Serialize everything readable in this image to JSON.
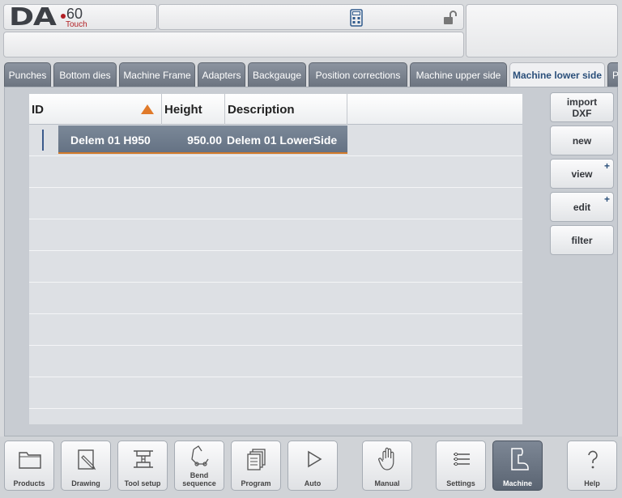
{
  "logo": {
    "brand": "DA",
    "model": "60",
    "touch": "Touch"
  },
  "tabs": [
    {
      "label": "Punches",
      "active": false
    },
    {
      "label": "Bottom dies",
      "active": false
    },
    {
      "label": "Machine Frame",
      "active": false
    },
    {
      "label": "Adapters",
      "active": false
    },
    {
      "label": "Backgauge",
      "active": false
    },
    {
      "label": "Position corrections",
      "active": false
    },
    {
      "label": "Machine upper side",
      "active": false
    },
    {
      "label": "Machine lower side",
      "active": true
    },
    {
      "label": "P",
      "active": false
    }
  ],
  "table": {
    "columns": [
      "ID",
      "Height",
      "Description"
    ],
    "rows": [
      {
        "id": "Delem 01 H950",
        "height": "950.00",
        "description": "Delem 01 LowerSide"
      }
    ]
  },
  "side_buttons": {
    "import_line1": "import",
    "import_line2": "DXF",
    "new": "new",
    "view": "view",
    "edit": "edit",
    "filter": "filter",
    "plus": "+"
  },
  "bottom_nav": {
    "products": "Products",
    "drawing": "Drawing",
    "tool_setup": "Tool setup",
    "bend_line1": "Bend",
    "bend_line2": "sequence",
    "program": "Program",
    "auto": "Auto",
    "manual": "Manual",
    "settings": "Settings",
    "machine": "Machine",
    "help": "Help"
  },
  "colors": {
    "accent": "#2a4f7a",
    "selected_row": "#6d7a8c",
    "sort_arrow": "#e07a2a",
    "selection_underline": "#d17a2a"
  }
}
